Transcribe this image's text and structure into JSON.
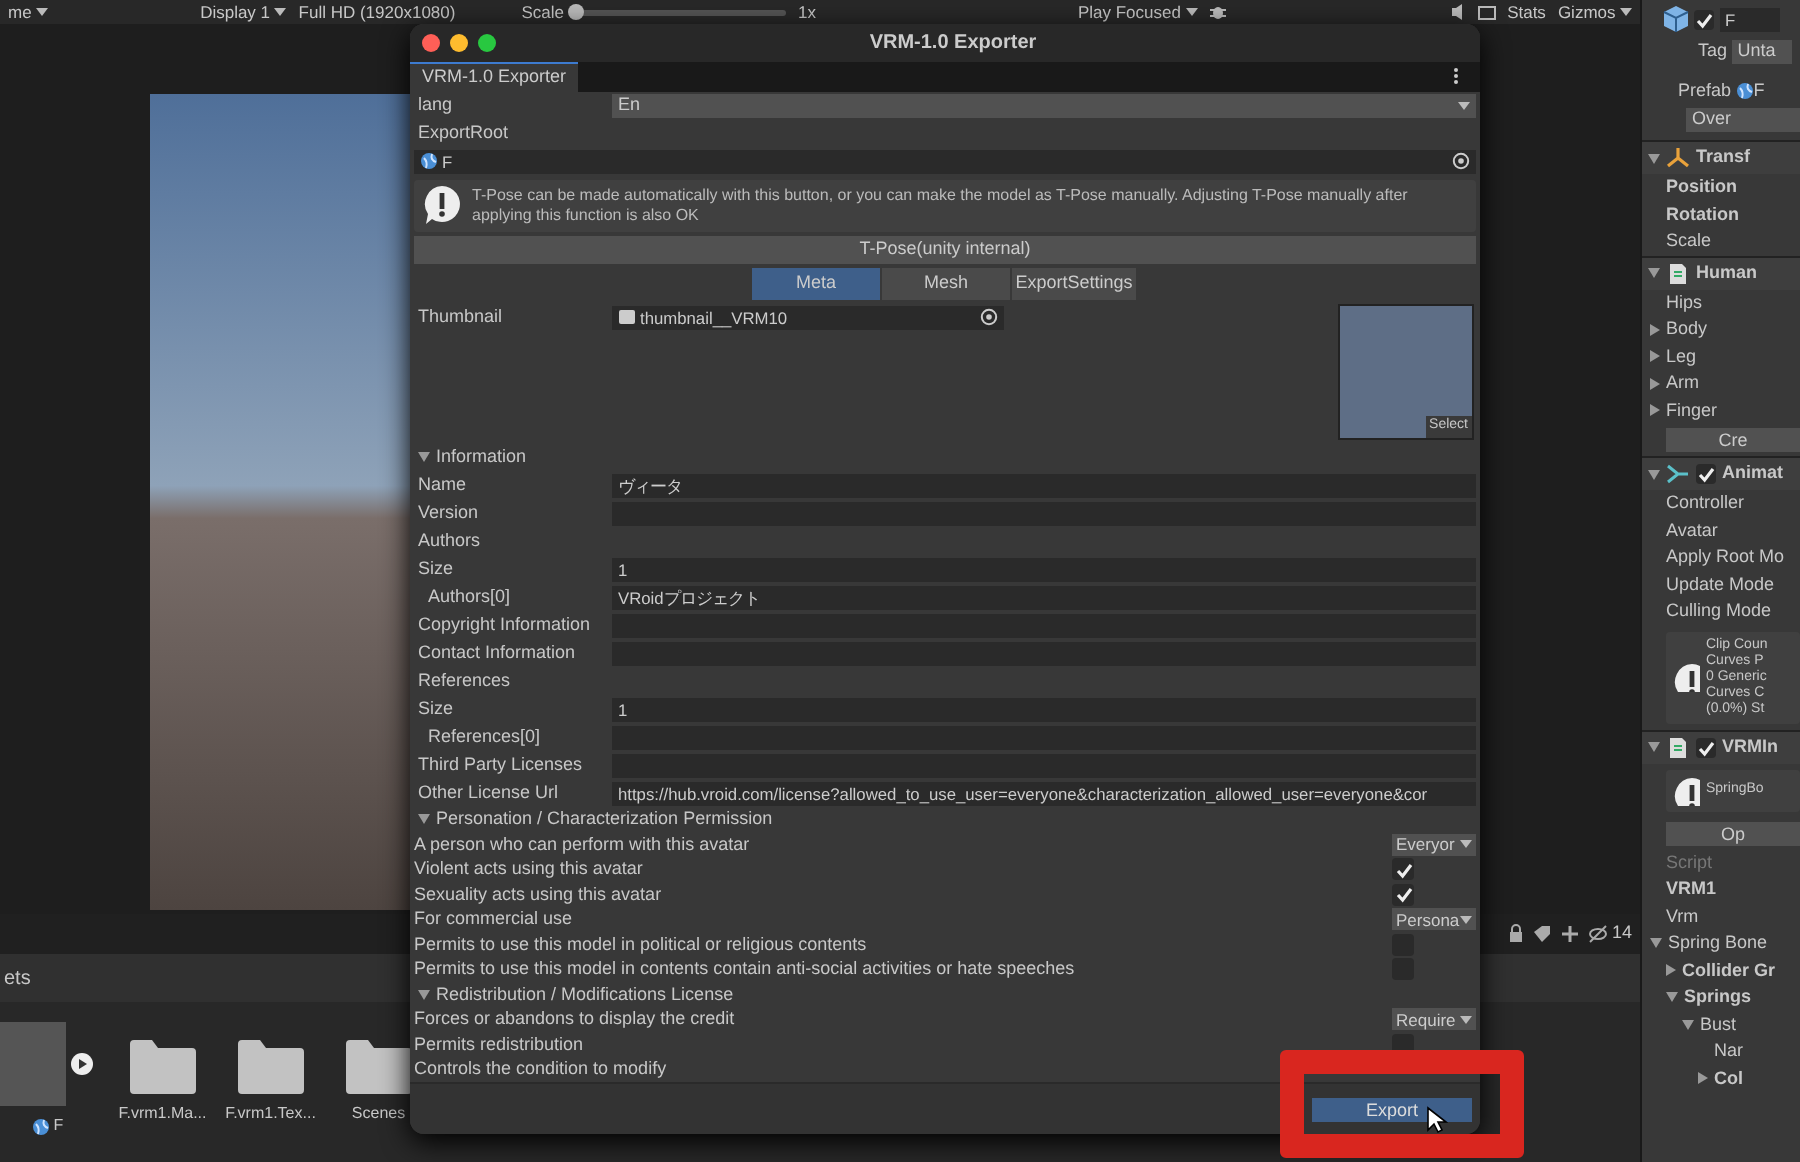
{
  "toolbar": {
    "menus": [
      "me",
      "Display 1",
      "Full HD (1920x1080)"
    ],
    "scale_label": "Scale",
    "scale_slider": {
      "level": 0
    },
    "scale_value": "1x",
    "play_mode": "Play Focused",
    "stats": "Stats",
    "gizmos": "Gizmos"
  },
  "project": {
    "hidden_count": "14",
    "title": "ets",
    "assets": [
      {
        "kind": "model",
        "label": "F"
      },
      {
        "kind": "folder",
        "label": "F.vrm1.Ma..."
      },
      {
        "kind": "folder",
        "label": "F.vrm1.Tex..."
      },
      {
        "kind": "folder",
        "label": "Scenes"
      }
    ]
  },
  "dialog": {
    "title": "VRM-1.0 Exporter",
    "tab": "VRM-1.0 Exporter",
    "lang": {
      "label": "lang",
      "value": "En"
    },
    "export_root": {
      "label": "ExportRoot",
      "value": "F"
    },
    "help_text": "T-Pose can be made automatically with this button, or you can make the model as T-Pose manually. Adjusting T-Pose manually after applying this function is also OK",
    "tpose_button": "T-Pose(unity internal)",
    "tabs": [
      {
        "label": "Meta",
        "selected": true
      },
      {
        "label": "Mesh",
        "selected": false
      },
      {
        "label": "ExportSettings",
        "selected": false
      }
    ],
    "thumbnail": {
      "label": "Thumbnail",
      "value": "thumbnail__VRM10",
      "select_label": "Select"
    },
    "sections": [
      {
        "title": "Information",
        "expanded": true,
        "rows": [
          {
            "kind": "field",
            "label": "Name",
            "value": "ヴィータ"
          },
          {
            "kind": "field",
            "label": "Version",
            "value": ""
          },
          {
            "kind": "header",
            "label": "Authors"
          },
          {
            "kind": "field",
            "label": "Size",
            "value": "1"
          },
          {
            "kind": "item",
            "label": "Authors[0]",
            "value": "VRoidプロジェクト"
          },
          {
            "kind": "field",
            "label": "Copyright Information",
            "value": ""
          },
          {
            "kind": "field",
            "label": "Contact Information",
            "value": ""
          },
          {
            "kind": "header",
            "label": "References"
          },
          {
            "kind": "field",
            "label": "Size",
            "value": "1"
          },
          {
            "kind": "item",
            "label": "References[0]",
            "value": ""
          },
          {
            "kind": "field",
            "label": "Third Party Licenses",
            "value": ""
          },
          {
            "kind": "field",
            "label": "Other License Url",
            "value": "https://hub.vroid.com/license?allowed_to_use_user=everyone&characterization_allowed_user=everyone&cor"
          }
        ]
      },
      {
        "title": "Personation / Characterization Permission",
        "expanded": true,
        "rows": [
          {
            "kind": "dropdown",
            "label": "A person who can perform with this avatar",
            "value": "Everyor"
          },
          {
            "kind": "checkbox",
            "label": "Violent acts using this avatar",
            "checked": true
          },
          {
            "kind": "checkbox",
            "label": "Sexuality acts using this avatar",
            "checked": true
          },
          {
            "kind": "dropdown",
            "label": "For commercial use",
            "value": "Persona"
          },
          {
            "kind": "checkbox",
            "label": "Permits to use this model in political or religious contents",
            "checked": false
          },
          {
            "kind": "checkbox",
            "label": "Permits to use this model in contents contain anti-social activities or hate speeches",
            "checked": false
          }
        ]
      },
      {
        "title": "Redistribution / Modifications License",
        "expanded": true,
        "rows": [
          {
            "kind": "dropdown",
            "label": "Forces or abandons to display the credit",
            "value": "Require"
          },
          {
            "kind": "checkbox",
            "label": "Permits redistribution",
            "checked": false
          },
          {
            "kind": "header",
            "label": "Controls the condition to modify"
          }
        ]
      }
    ],
    "export_button": "Export"
  },
  "inspector": {
    "object": {
      "active": true,
      "name": "F",
      "tag_label": "Tag",
      "tag_value": "Unta",
      "prefab_label": "Prefab",
      "prefab_value": "F",
      "overrides": "Over"
    },
    "components": [
      {
        "title": "Transf",
        "rows": [
          {
            "kind": "bold",
            "label": "Position"
          },
          {
            "kind": "bold",
            "label": "Rotation"
          },
          {
            "kind": "label",
            "label": "Scale"
          }
        ]
      },
      {
        "title": "Human",
        "rows": [
          {
            "kind": "label",
            "label": "Hips"
          },
          {
            "kind": "foldout",
            "label": "Body",
            "expanded": false
          },
          {
            "kind": "foldout",
            "label": "Leg",
            "expanded": false
          },
          {
            "kind": "foldout",
            "label": "Arm",
            "expanded": false
          },
          {
            "kind": "foldout",
            "label": "Finger",
            "expanded": false
          },
          {
            "kind": "button",
            "label": "Cre"
          }
        ]
      },
      {
        "title": "Animat",
        "enabled": true,
        "rows": [
          {
            "kind": "label",
            "label": "Controller"
          },
          {
            "kind": "label",
            "label": "Avatar"
          },
          {
            "kind": "label",
            "label": "Apply Root Mo"
          },
          {
            "kind": "label",
            "label": "Update Mode"
          },
          {
            "kind": "label",
            "label": "Culling Mode"
          },
          {
            "kind": "help",
            "lines": [
              "Clip Coun",
              "Curves P",
              "0 Generic",
              "Curves C",
              "(0.0%) St"
            ]
          }
        ]
      },
      {
        "title": "VRMIn",
        "enabled": true,
        "rows": [
          {
            "kind": "help",
            "lines": [
              "SpringBo"
            ]
          },
          {
            "kind": "button",
            "label": "Op"
          },
          {
            "kind": "disabled",
            "label": "Script"
          },
          {
            "kind": "bold",
            "label": "VRM1"
          },
          {
            "kind": "label",
            "label": "Vrm"
          },
          {
            "kind": "foldout",
            "label": "Spring Bone",
            "expanded": true,
            "children": [
              {
                "kind": "foldout",
                "label": "Collider Gr",
                "expanded": false,
                "bold": true
              },
              {
                "kind": "foldout",
                "label": "Springs",
                "expanded": true,
                "bold": true,
                "children": [
                  {
                    "kind": "foldout",
                    "label": "Bust",
                    "expanded": true,
                    "children": [
                      {
                        "kind": "label",
                        "label": "Nar"
                      },
                      {
                        "kind": "foldout",
                        "label": "Col",
                        "expanded": false,
                        "bold": true
                      }
                    ]
                  }
                ]
              }
            ]
          }
        ]
      }
    ]
  }
}
